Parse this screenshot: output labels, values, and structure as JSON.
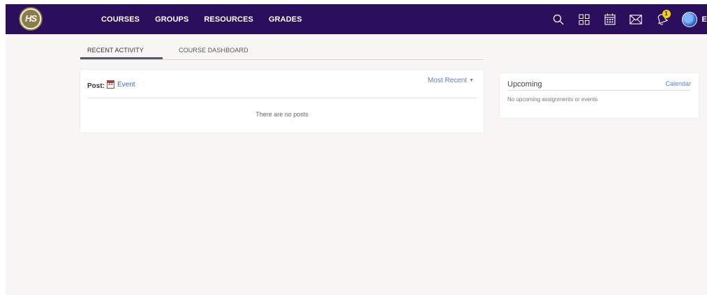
{
  "logo": {
    "text": "HS"
  },
  "nav": {
    "items": [
      "COURSES",
      "GROUPS",
      "RESOURCES",
      "GRADES"
    ],
    "badge_count": "1",
    "user_name": "Es"
  },
  "icons": [
    "search-icon",
    "apps-grid-icon",
    "calendar-icon",
    "mail-icon",
    "bell-icon",
    "avatar"
  ],
  "colors": {
    "nav_bg": "#2c0f5c",
    "badge": "#f2d400",
    "link": "#5b7fc4"
  },
  "tabs": [
    {
      "label": "RECENT ACTIVITY",
      "active": true
    },
    {
      "label": "COURSE DASHBOARD",
      "active": false
    }
  ],
  "post": {
    "label": "Post:",
    "event_icon_day": "21",
    "event_label": "Event",
    "sort_label": "Most Recent",
    "empty_message": "There are no posts"
  },
  "upcoming": {
    "title": "Upcoming",
    "calendar_link": "Calendar",
    "empty_message": "No upcoming assignments or events"
  }
}
